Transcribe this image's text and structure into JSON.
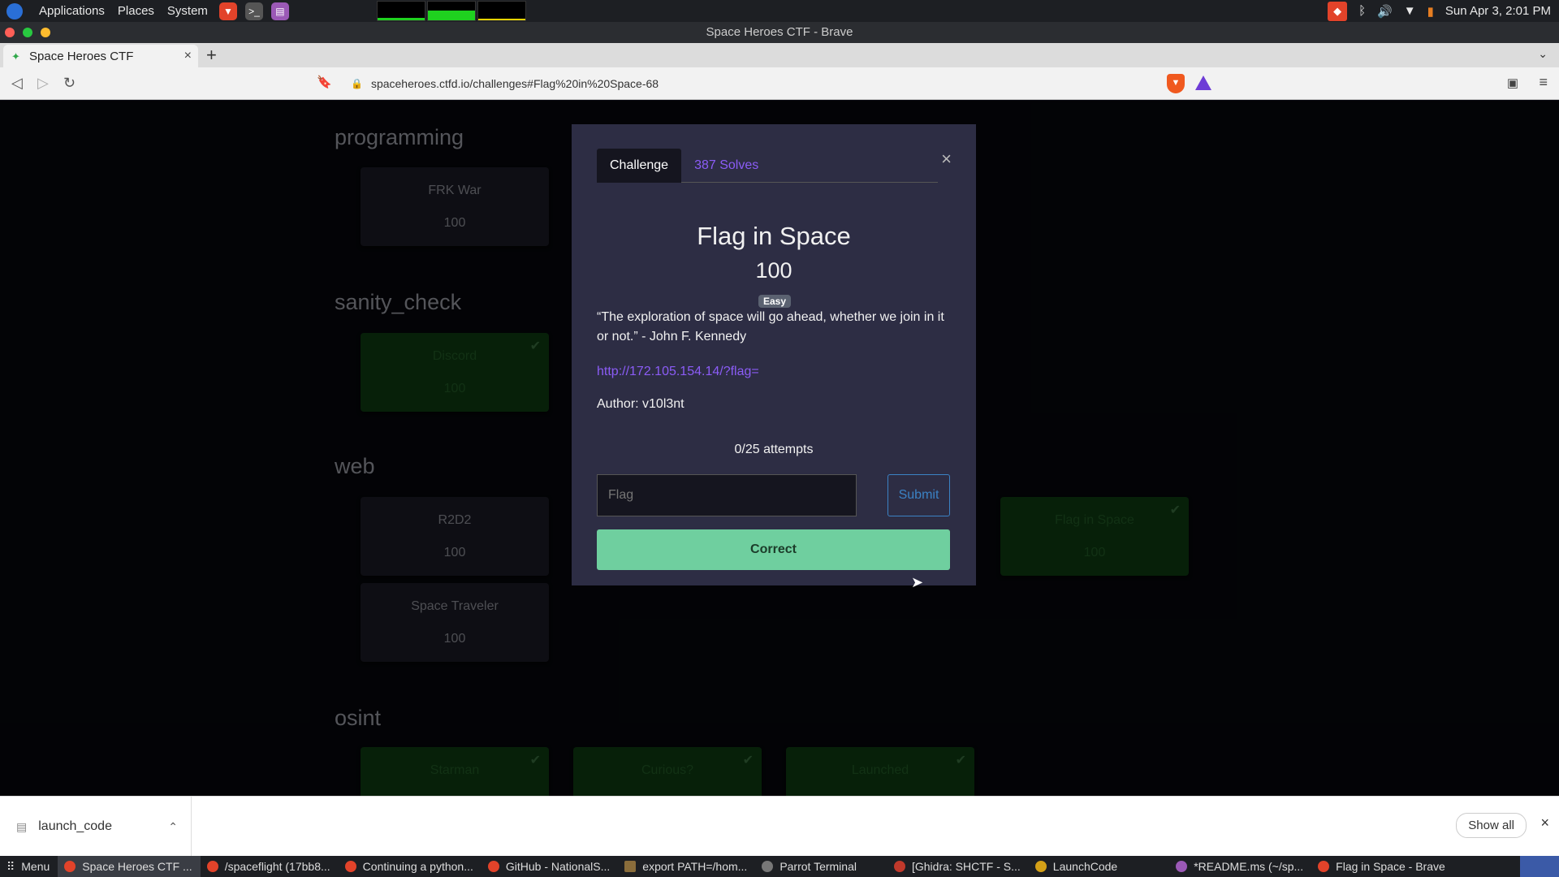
{
  "system_bar": {
    "applications": "Applications",
    "places": "Places",
    "system": "System",
    "clock": "Sun Apr 3,  2:01 PM"
  },
  "window": {
    "title": "Space Heroes CTF - Brave"
  },
  "browser": {
    "tab_title": "Space Heroes CTF",
    "url": "spaceheroes.ctfd.io/challenges#Flag%20in%20Space-68"
  },
  "page": {
    "categories": [
      {
        "name": "programming",
        "cards": [
          {
            "name": "FRK War",
            "value": "100",
            "solved": false
          }
        ]
      },
      {
        "name": "sanity_check",
        "cards": [
          {
            "name": "Discord",
            "value": "100",
            "solved": true
          }
        ]
      },
      {
        "name": "web",
        "cards": [
          {
            "name": "R2D2",
            "value": "100",
            "solved": false
          },
          {
            "name": "Space Traveler",
            "value": "100",
            "solved": false
          },
          {
            "name": "Flag in Space",
            "value": "100",
            "solved": true
          }
        ]
      },
      {
        "name": "osint",
        "cards": [
          {
            "name": "Starman",
            "value": "",
            "solved": true
          },
          {
            "name": "Curious?",
            "value": "",
            "solved": true
          },
          {
            "name": "Launched",
            "value": "",
            "solved": true
          }
        ]
      }
    ]
  },
  "modal": {
    "tab_challenge": "Challenge",
    "tab_solves": "387 Solves",
    "close": "×",
    "title": "Flag in Space",
    "value": "100",
    "badge": "Easy",
    "description": "“The exploration of space will go ahead, whether we join in it or not.” - John F. Kennedy",
    "link": "http://172.105.154.14/?flag=",
    "author": "Author: v10l3nt",
    "attempts": "0/25 attempts",
    "flag_placeholder": "Flag",
    "submit_label": "Submit",
    "result": "Correct"
  },
  "downloads": {
    "file": "launch_code",
    "show_all": "Show all"
  },
  "taskbar": {
    "menu": "Menu",
    "items": [
      "Space Heroes CTF ...",
      "/spaceflight (17bb8...",
      "Continuing a python...",
      "GitHub - NationalS...",
      "export PATH=/hom...",
      "Parrot Terminal",
      "[Ghidra: SHCTF - S...",
      "LaunchCode",
      "*README.ms (~/sp...",
      "Flag in Space - Brave"
    ]
  }
}
